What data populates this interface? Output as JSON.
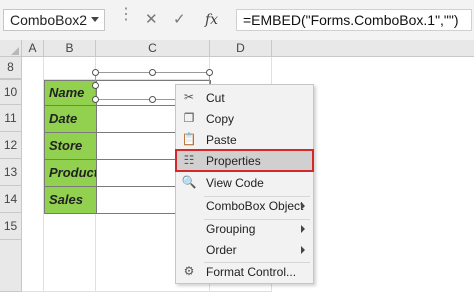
{
  "formula_bar": {
    "name_box": "ComboBox2",
    "fx_label": "fx",
    "formula": "=EMBED(\"Forms.ComboBox.1\",\"\")"
  },
  "columns": [
    "A",
    "B",
    "C",
    "D"
  ],
  "rows": [
    "8",
    "9",
    "10",
    "11",
    "12",
    "13",
    "14",
    "15"
  ],
  "table": {
    "labels": [
      "Name",
      "Date",
      "Store",
      "Product",
      "Sales"
    ]
  },
  "context_menu": {
    "items": [
      {
        "label": "Cut",
        "icon": "scissors-icon",
        "submenu": false
      },
      {
        "label": "Copy",
        "icon": "copy-icon",
        "submenu": false
      },
      {
        "label": "Paste",
        "icon": "paste-icon",
        "submenu": false
      },
      {
        "label": "Properties",
        "icon": "properties-icon",
        "submenu": false,
        "highlighted": true
      },
      {
        "label": "View Code",
        "icon": "view-code-icon",
        "submenu": false
      },
      {
        "label": "ComboBox Object",
        "icon": "",
        "submenu": true
      },
      {
        "label": "Grouping",
        "icon": "",
        "submenu": true
      },
      {
        "label": "Order",
        "icon": "",
        "submenu": true
      },
      {
        "label": "Format Control...",
        "icon": "format-control-icon",
        "submenu": false
      }
    ]
  },
  "colors": {
    "label_fill": "#92d050",
    "highlight_border": "#d62828",
    "menu_bg": "#f2f2f2"
  }
}
